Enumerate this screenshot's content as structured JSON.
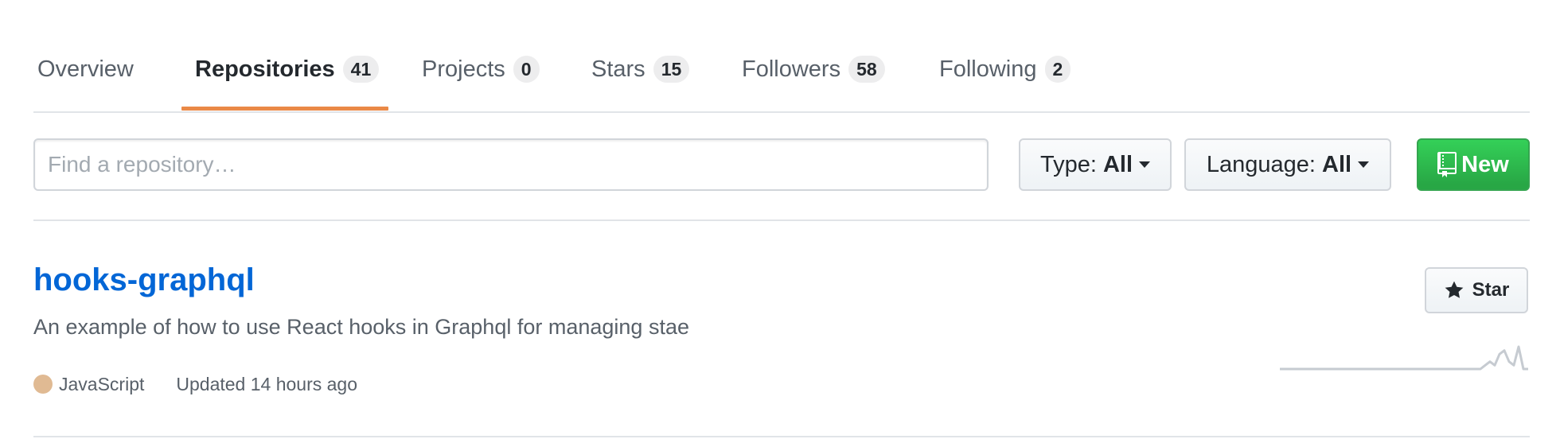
{
  "tabs": [
    {
      "label": "Overview",
      "count": null,
      "selected": false
    },
    {
      "label": "Repositories",
      "count": "41",
      "selected": true
    },
    {
      "label": "Projects",
      "count": "0",
      "selected": false
    },
    {
      "label": "Stars",
      "count": "15",
      "selected": false
    },
    {
      "label": "Followers",
      "count": "58",
      "selected": false
    },
    {
      "label": "Following",
      "count": "2",
      "selected": false
    }
  ],
  "filters": {
    "search_placeholder": "Find a repository…",
    "type_prefix": "Type:",
    "type_value": "All",
    "language_prefix": "Language:",
    "language_value": "All",
    "new_label": "New"
  },
  "repo": {
    "name": "hooks-graphql",
    "description": "An example of how to use React hooks in Graphql for managing stae",
    "language": "JavaScript",
    "language_color": "#e0ba93",
    "updated": "Updated 14 hours ago",
    "star_label": "Star",
    "activity": [
      0,
      0,
      0,
      0,
      0,
      0,
      0,
      0,
      0,
      0,
      0,
      0,
      0,
      0,
      0,
      0,
      0,
      0,
      0,
      0,
      0,
      0,
      0,
      0,
      0,
      0,
      0,
      0,
      0,
      0,
      0,
      0,
      0,
      0,
      0,
      0,
      0,
      0,
      0,
      0,
      0,
      0,
      0,
      1,
      2,
      1,
      4,
      5,
      2,
      1,
      6,
      0,
      0
    ]
  },
  "colors": {
    "link": "#0366d6",
    "tab_underline": "#e36209",
    "new_button": "#28a745",
    "muted_text": "#586069"
  }
}
